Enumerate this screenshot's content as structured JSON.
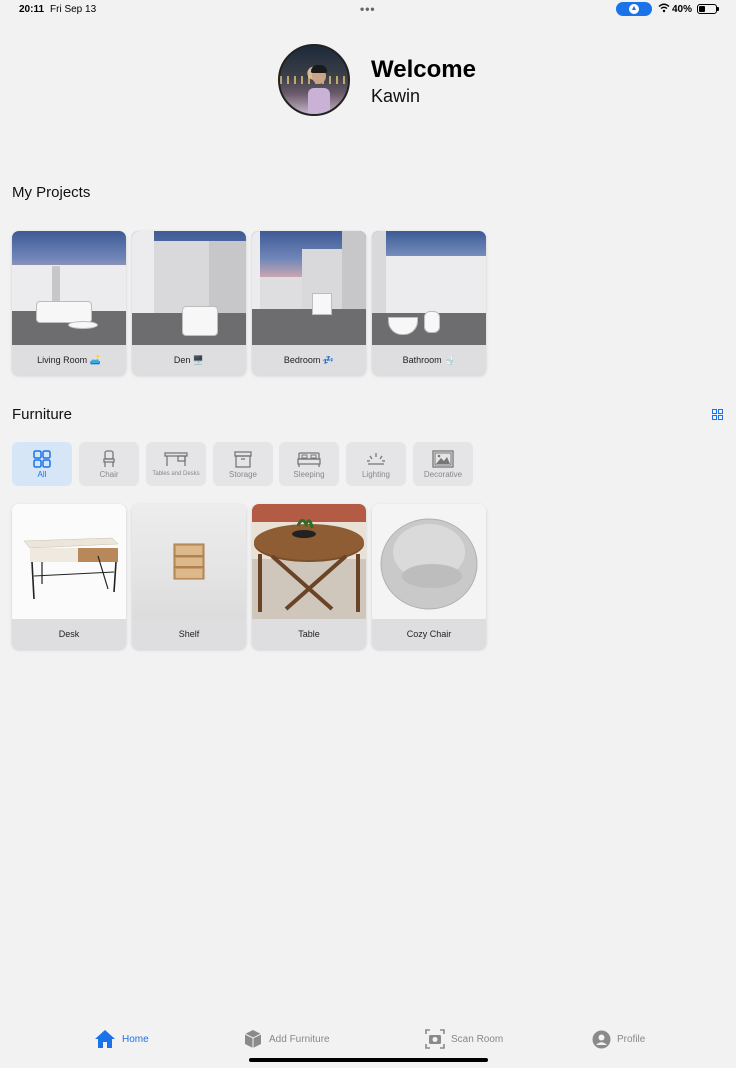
{
  "status_bar": {
    "time": "20:11",
    "date": "Fri Sep 13",
    "battery": "40%",
    "dots": "•••"
  },
  "header": {
    "welcome": "Welcome",
    "username": "Kawin"
  },
  "projects": {
    "title": "My Projects",
    "items": [
      {
        "label": "Living Room 🛋️"
      },
      {
        "label": "Den 🖥️"
      },
      {
        "label": "Bedroom 💤"
      },
      {
        "label": "Bathroom 🚽"
      }
    ]
  },
  "furniture": {
    "title": "Furniture",
    "categories": [
      {
        "label": "All",
        "icon": "grid-icon"
      },
      {
        "label": "Chair",
        "icon": "chair-icon"
      },
      {
        "label": "Tables and Desks",
        "icon": "desk-icon"
      },
      {
        "label": "Storage",
        "icon": "storage-box-icon"
      },
      {
        "label": "Sleeping",
        "icon": "bed-icon"
      },
      {
        "label": "Lighting",
        "icon": "light-icon"
      },
      {
        "label": "Decorative",
        "icon": "picture-icon"
      }
    ],
    "items": [
      {
        "label": "Desk"
      },
      {
        "label": "Shelf"
      },
      {
        "label": "Table"
      },
      {
        "label": "Cozy Chair"
      }
    ]
  },
  "tab_bar": {
    "items": [
      {
        "label": "Home",
        "icon": "house-icon"
      },
      {
        "label": "Add Furniture",
        "icon": "cube-icon"
      },
      {
        "label": "Scan Room",
        "icon": "camera-scan-icon"
      },
      {
        "label": "Profile",
        "icon": "person-circle-icon"
      }
    ]
  },
  "colors": {
    "accent": "#1a73e8",
    "background": "#f2f2f3",
    "card": "#dedee0"
  }
}
